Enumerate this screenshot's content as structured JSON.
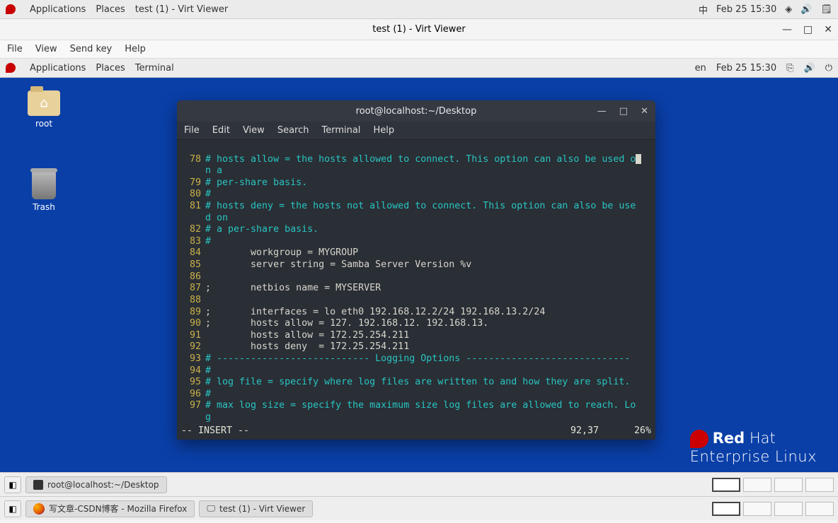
{
  "outer_topbar": {
    "apps": "Applications",
    "places": "Places",
    "active_app": "test (1) - Virt Viewer",
    "ime": "中",
    "datetime": "Feb 25  15:30"
  },
  "virtviewer": {
    "title": "test (1) - Virt Viewer",
    "menu": {
      "file": "File",
      "view": "View",
      "sendkey": "Send key",
      "help": "Help"
    }
  },
  "inner_topbar": {
    "apps": "Applications",
    "places": "Places",
    "active_app": "Terminal",
    "lang": "en",
    "datetime": "Feb 25  15:30"
  },
  "desktop_icons": {
    "root": "root",
    "trash": "Trash"
  },
  "terminal": {
    "title": "root@localhost:~/Desktop",
    "menu": {
      "file": "File",
      "edit": "Edit",
      "view": "View",
      "search": "Search",
      "terminal": "Terminal",
      "help": "Help"
    },
    "lines": {
      "l78a": "# hosts allow = the hosts allowed to connect. This option can also be used o",
      "l78b": "n a",
      "l79": "# per-share basis.",
      "l80": "#",
      "l81a": "# hosts deny = the hosts not allowed to connect. This option can also be use",
      "l81b": "d on",
      "l82": "# a per-share basis.",
      "l83": "#",
      "l84": "        workgroup = MYGROUP",
      "l85": "        server string = Samba Server Version %v",
      "l86": "",
      "l87": ";       netbios name = MYSERVER",
      "l88": "",
      "l89": ";       interfaces = lo eth0 192.168.12.2/24 192.168.13.2/24",
      "l90": ";       hosts allow = 127. 192.168.12. 192.168.13.",
      "l91": "        hosts allow = 172.25.254.211",
      "l92": "        hosts deny  = 172.25.254.211",
      "l93": "# --------------------------- Logging Options -----------------------------",
      "l94": "#",
      "l95": "# log file = specify where log files are written to and how they are split.",
      "l96": "#",
      "l97a": "# max log size = specify the maximum size log files are allowed to reach. Lo",
      "l97b": "g"
    },
    "status": {
      "mode": "-- INSERT --",
      "pos": "92,37",
      "pct": "26%"
    }
  },
  "branding": {
    "line1a": "Red",
    "line1b": "Hat",
    "line2": "Enterprise Linux"
  },
  "inner_taskbar": {
    "task1": "root@localhost:~/Desktop"
  },
  "outer_taskbar": {
    "task1": "写文章-CSDN博客 - Mozilla Firefox",
    "task2": "test (1) - Virt Viewer"
  },
  "watermark": ""
}
